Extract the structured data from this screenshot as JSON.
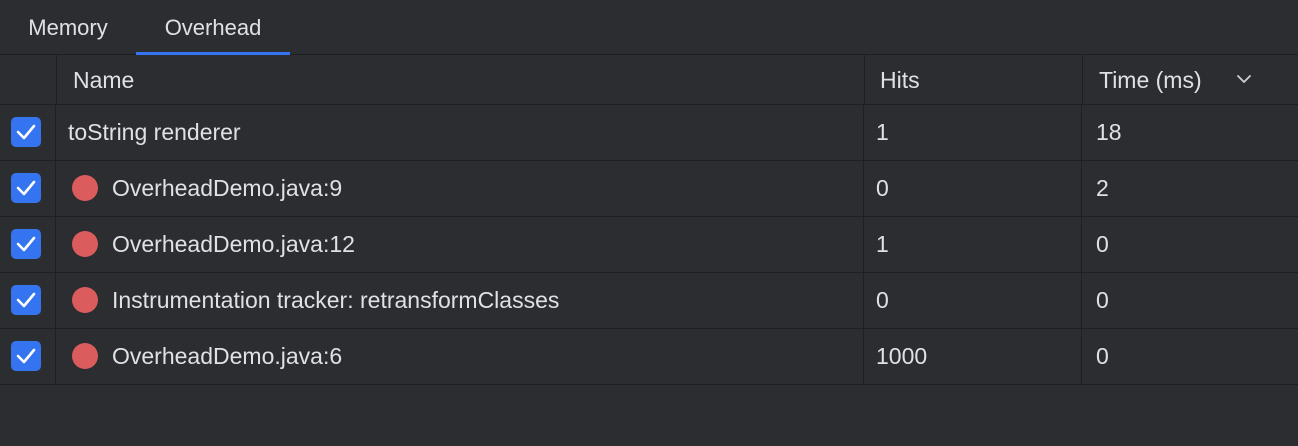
{
  "tabs": [
    {
      "label": "Memory",
      "active": false
    },
    {
      "label": "Overhead",
      "active": true
    }
  ],
  "columns": {
    "name": "Name",
    "hits": "Hits",
    "time": "Time (ms)"
  },
  "sort": {
    "column": "time",
    "direction": "descending",
    "icon": "chevron-down-icon"
  },
  "rows": [
    {
      "checked": true,
      "icon": "none",
      "name": "toString renderer",
      "hits": "1",
      "time": "18"
    },
    {
      "checked": true,
      "icon": "breakpoint-icon",
      "name": "OverheadDemo.java:9",
      "hits": "0",
      "time": "2"
    },
    {
      "checked": true,
      "icon": "breakpoint-icon",
      "name": "OverheadDemo.java:12",
      "hits": "1",
      "time": "0"
    },
    {
      "checked": true,
      "icon": "breakpoint-icon",
      "name": "Instrumentation tracker: retransformClasses",
      "hits": "0",
      "time": "0"
    },
    {
      "checked": true,
      "icon": "breakpoint-icon",
      "name": "OverheadDemo.java:6",
      "hits": "1000",
      "time": "0"
    }
  ],
  "colors": {
    "background": "#2b2d30",
    "accent": "#3574f0",
    "breakpoint": "#db5c5c",
    "text": "#dfe1e5"
  }
}
